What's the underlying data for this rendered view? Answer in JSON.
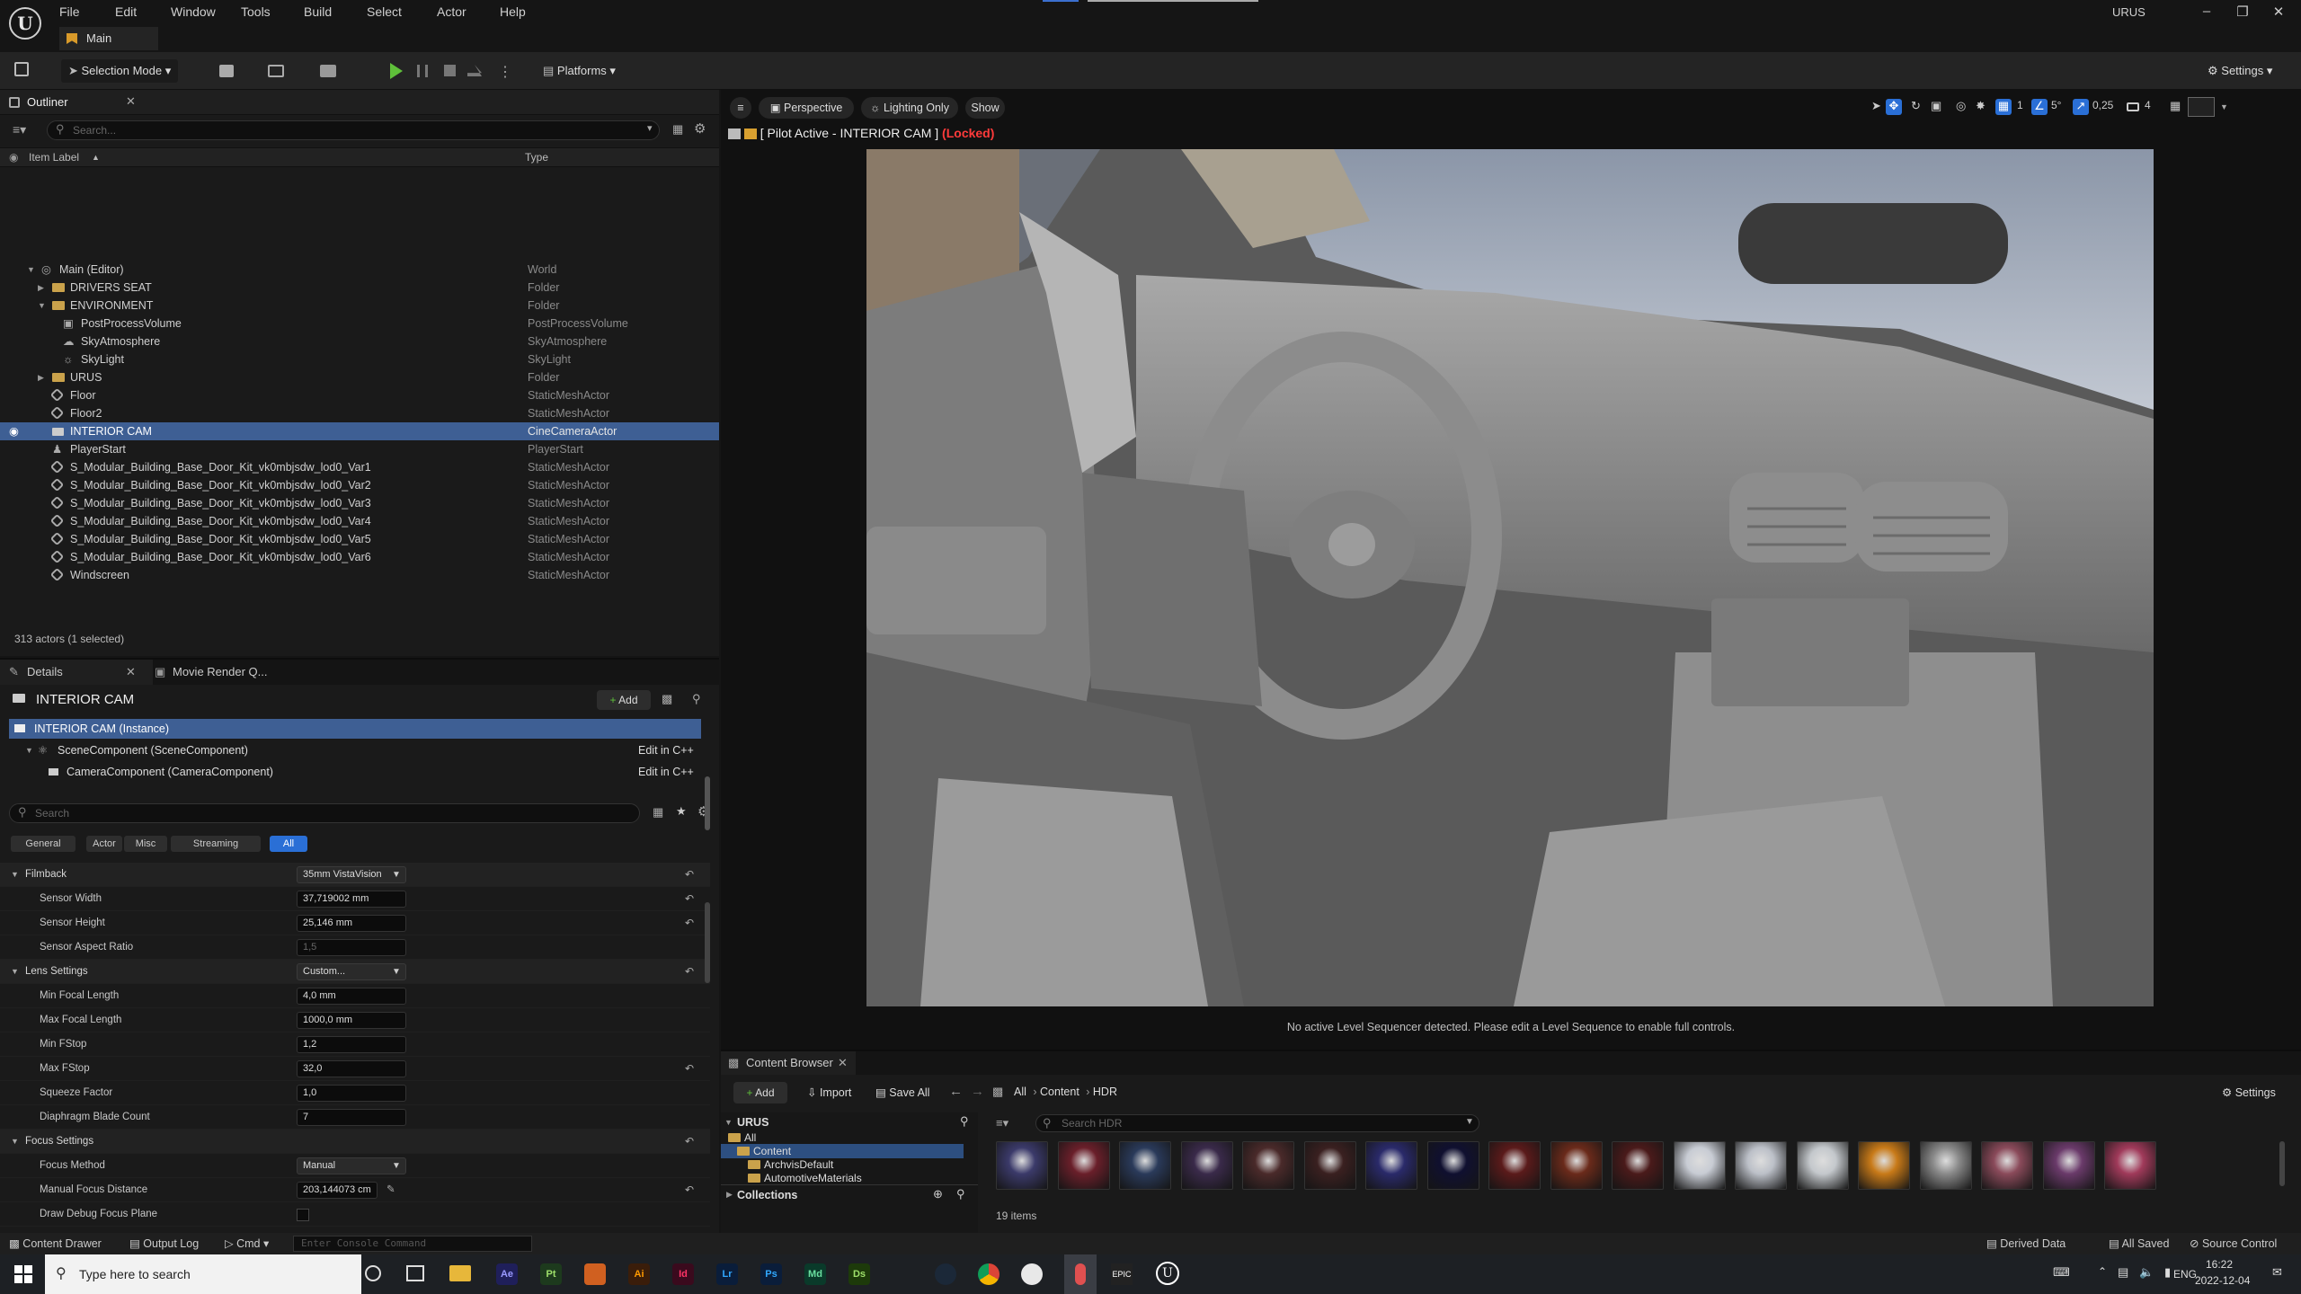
{
  "menu": [
    "File",
    "Edit",
    "Window",
    "Tools",
    "Build",
    "Select",
    "Actor",
    "Help"
  ],
  "tab_main": "Main",
  "project_name": "URUS",
  "window_controls": [
    "minimize-icon",
    "restore-icon",
    "close-icon"
  ],
  "toolbar": {
    "selection_mode": "Selection Mode",
    "platforms": "Platforms",
    "settings": "Settings"
  },
  "outliner": {
    "title": "Outliner",
    "search_placeholder": "Search...",
    "col_label": "Item Label",
    "col_type": "Type",
    "rows": [
      {
        "label": "Main (Editor)",
        "type": "World"
      },
      {
        "label": "DRIVERS SEAT",
        "type": "Folder"
      },
      {
        "label": "ENVIRONMENT",
        "type": "Folder"
      },
      {
        "label": "PostProcessVolume",
        "type": "PostProcessVolume"
      },
      {
        "label": "SkyAtmosphere",
        "type": "SkyAtmosphere"
      },
      {
        "label": "SkyLight",
        "type": "SkyLight"
      },
      {
        "label": "URUS",
        "type": "Folder"
      },
      {
        "label": "Floor",
        "type": "StaticMeshActor"
      },
      {
        "label": "Floor2",
        "type": "StaticMeshActor"
      },
      {
        "label": "INTERIOR CAM",
        "type": "CineCameraActor"
      },
      {
        "label": "PlayerStart",
        "type": "PlayerStart"
      },
      {
        "label": "S_Modular_Building_Base_Door_Kit_vk0mbjsdw_lod0_Var1",
        "type": "StaticMeshActor"
      },
      {
        "label": "S_Modular_Building_Base_Door_Kit_vk0mbjsdw_lod0_Var2",
        "type": "StaticMeshActor"
      },
      {
        "label": "S_Modular_Building_Base_Door_Kit_vk0mbjsdw_lod0_Var3",
        "type": "StaticMeshActor"
      },
      {
        "label": "S_Modular_Building_Base_Door_Kit_vk0mbjsdw_lod0_Var4",
        "type": "StaticMeshActor"
      },
      {
        "label": "S_Modular_Building_Base_Door_Kit_vk0mbjsdw_lod0_Var5",
        "type": "StaticMeshActor"
      },
      {
        "label": "S_Modular_Building_Base_Door_Kit_vk0mbjsdw_lod0_Var6",
        "type": "StaticMeshActor"
      },
      {
        "label": "Windscreen",
        "type": "StaticMeshActor"
      }
    ],
    "actor_count": "313 actors (1 selected)"
  },
  "details": {
    "tab_details": "Details",
    "tab_movie": "Movie Render Q...",
    "actor_name": "INTERIOR CAM",
    "add_label": "Add",
    "instance": "INTERIOR CAM (Instance)",
    "scene_component": "SceneComponent (SceneComponent)",
    "camera_component": "CameraComponent (CameraComponent)",
    "edit_cpp": "Edit in C++",
    "search_placeholder": "Search",
    "filters": [
      "General",
      "Actor",
      "Misc",
      "Streaming",
      "All"
    ],
    "props": [
      {
        "label": "Filmback",
        "value": "35mm VistaVision",
        "kind": "cat-dd"
      },
      {
        "label": "Sensor Width",
        "value": "37,719002 mm",
        "kind": "field"
      },
      {
        "label": "Sensor Height",
        "value": "25,146 mm",
        "kind": "field"
      },
      {
        "label": "Sensor Aspect Ratio",
        "value": "1,5",
        "kind": "dis"
      },
      {
        "label": "Lens Settings",
        "value": "Custom...",
        "kind": "cat-dd"
      },
      {
        "label": "Min Focal Length",
        "value": "4,0 mm",
        "kind": "field"
      },
      {
        "label": "Max Focal Length",
        "value": "1000,0 mm",
        "kind": "field"
      },
      {
        "label": "Min FStop",
        "value": "1,2",
        "kind": "field"
      },
      {
        "label": "Max FStop",
        "value": "32,0",
        "kind": "field"
      },
      {
        "label": "Squeeze Factor",
        "value": "1,0",
        "kind": "field"
      },
      {
        "label": "Diaphragm Blade Count",
        "value": "7",
        "kind": "field"
      },
      {
        "label": "Focus Settings",
        "value": "",
        "kind": "cat"
      },
      {
        "label": "Focus Method",
        "value": "Manual",
        "kind": "dd"
      },
      {
        "label": "Manual Focus Distance",
        "value": "203,144073 cm",
        "kind": "field"
      },
      {
        "label": "Draw Debug Focus Plane",
        "value": "",
        "kind": "check"
      }
    ]
  },
  "viewport": {
    "perspective": "Perspective",
    "lighting": "Lighting Only",
    "show": "Show",
    "pilot_text": "[ Pilot Active - INTERIOR CAM ]",
    "locked": "(Locked)",
    "snap_grid": "1",
    "snap_rot": "5°",
    "snap_scale": "0,25",
    "cam_speed": "4",
    "no_sequencer": "No active Level Sequencer detected. Please edit a Level Sequence to enable full controls."
  },
  "content_browser": {
    "title": "Content Browser",
    "add": "Add",
    "import": "Import",
    "save_all": "Save All",
    "breadcrumb": [
      "All",
      "Content",
      "HDR"
    ],
    "settings": "Settings",
    "root": "URUS",
    "tree": [
      "All",
      "Content",
      "ArchvisDefault",
      "AutomotiveMaterials"
    ],
    "collections": "Collections",
    "search_placeholder": "Search HDR",
    "item_count": "19 items",
    "thumb_colors": [
      "#3b3a6a",
      "#6a1f2a",
      "#2a3a5a",
      "#3a2a4a",
      "#4a2a2a",
      "#3a2020",
      "#2a2a6a",
      "#101030",
      "#5a1a1a",
      "#6a2a1a",
      "#4a1a1a",
      "#c8ccd4",
      "#bcc0c8",
      "#c4c8cc",
      "#c87a18",
      "#8a8a8a",
      "#8a4a5a",
      "#6a3a6a",
      "#a03a5a"
    ]
  },
  "status": {
    "content_drawer": "Content Drawer",
    "output_log": "Output Log",
    "cmd": "Cmd",
    "console_placeholder": "Enter Console Command",
    "derived": "Derived Data",
    "saved": "All Saved",
    "source": "Source Control"
  },
  "taskbar": {
    "search_placeholder": "Type here to search",
    "apps": [
      {
        "t": "Ae",
        "c": "#1f1f5a",
        "f": "#9999ff"
      },
      {
        "t": "Pt",
        "c": "#1d3a1d",
        "f": "#9ee06a"
      },
      {
        "t": "",
        "c": "#d06020",
        "f": "#fff"
      },
      {
        "t": "Ai",
        "c": "#3a1d0a",
        "f": "#ff9a00"
      },
      {
        "t": "Id",
        "c": "#3a0a1d",
        "f": "#ff3366"
      },
      {
        "t": "Lr",
        "c": "#0a1d3a",
        "f": "#31a8ff"
      },
      {
        "t": "Ps",
        "c": "#0a1d3a",
        "f": "#31a8ff"
      },
      {
        "t": "Md",
        "c": "#0a3a2a",
        "f": "#6adfa0"
      },
      {
        "t": "Ds",
        "c": "#1d3a0a",
        "f": "#9ee06a"
      }
    ],
    "lang": "ENG",
    "time": "16:22",
    "date": "2022-12-04"
  }
}
